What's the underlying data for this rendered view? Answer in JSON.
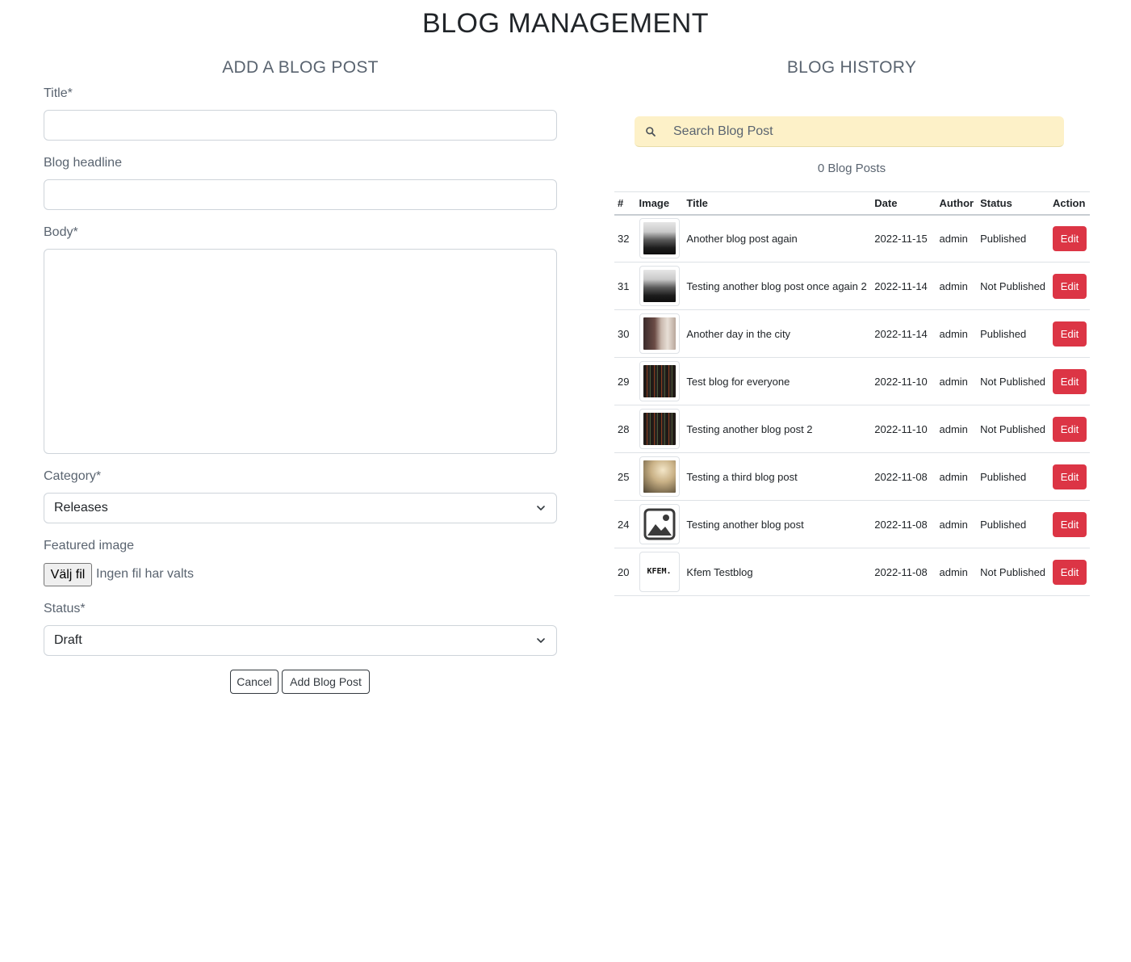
{
  "page_title": "BLOG MANAGEMENT",
  "add_section": {
    "title": "ADD A BLOG POST",
    "fields": {
      "title_label": "Title*",
      "title_value": "",
      "headline_label": "Blog headline",
      "headline_value": "",
      "body_label": "Body*",
      "body_value": "",
      "category_label": "Category*",
      "category_selected": "Releases",
      "featured_image_label": "Featured image",
      "file_button": "Välj fil",
      "file_status": "Ingen fil har valts",
      "status_label": "Status*",
      "status_selected": "Draft"
    },
    "cancel_button": "Cancel",
    "add_button": "Add Blog Post"
  },
  "history_section": {
    "title": "BLOG HISTORY",
    "search_placeholder": "Search Blog Post",
    "count_text": "0 Blog Posts",
    "columns": [
      "#",
      "Image",
      "Title",
      "Date",
      "Author",
      "Status",
      "Action"
    ],
    "rows": [
      {
        "id": "32",
        "image": "car-photo",
        "title": "Another blog post again",
        "date": "2022-11-15",
        "author": "admin",
        "status": "Published",
        "action": "Edit"
      },
      {
        "id": "31",
        "image": "car-photo",
        "title": "Testing another blog post once again 2",
        "date": "2022-11-14",
        "author": "admin",
        "status": "Not Published",
        "action": "Edit"
      },
      {
        "id": "30",
        "image": "portrait-photo",
        "title": "Another day in the city",
        "date": "2022-11-14",
        "author": "admin",
        "status": "Published",
        "action": "Edit"
      },
      {
        "id": "29",
        "image": "stripes-photo",
        "title": "Test blog for everyone",
        "date": "2022-11-10",
        "author": "admin",
        "status": "Not Published",
        "action": "Edit"
      },
      {
        "id": "28",
        "image": "stripes-photo",
        "title": "Testing another blog post 2",
        "date": "2022-11-10",
        "author": "admin",
        "status": "Not Published",
        "action": "Edit"
      },
      {
        "id": "25",
        "image": "foggy-photo",
        "title": "Testing a third blog post",
        "date": "2022-11-08",
        "author": "admin",
        "status": "Published",
        "action": "Edit"
      },
      {
        "id": "24",
        "image": "image-placeholder-icon",
        "title": "Testing another blog post",
        "date": "2022-11-08",
        "author": "admin",
        "status": "Published",
        "action": "Edit"
      },
      {
        "id": "20",
        "image": "kfem-logo",
        "image_text": "KFEM.",
        "title": "Kfem Testblog",
        "date": "2022-11-08",
        "author": "admin",
        "status": "Not Published",
        "action": "Edit"
      }
    ]
  },
  "colors": {
    "edit_button": "#dc3545",
    "search_background": "#fdf1c8",
    "muted_text": "#5a6470"
  }
}
